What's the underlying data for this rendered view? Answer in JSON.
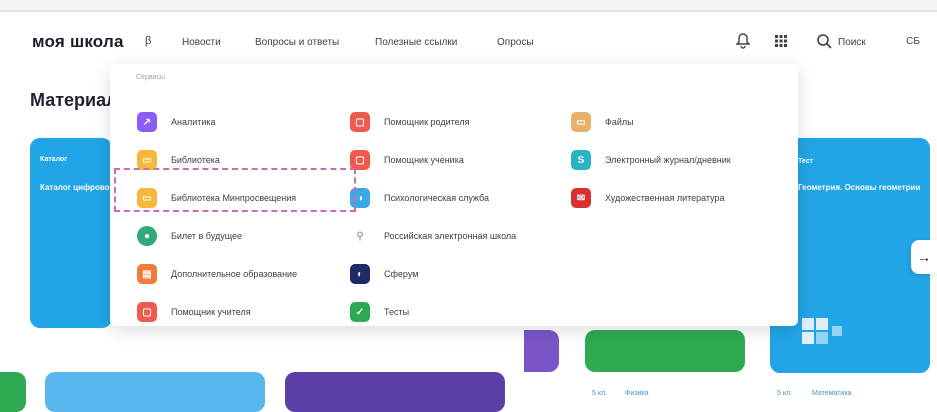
{
  "header": {
    "logo": "моя школа",
    "beta": "β",
    "nav": [
      "Новости",
      "Вопросы и ответы",
      "Полезные ссылки",
      "Опросы"
    ],
    "search_label": "Поиск",
    "avatar_initials": "СБ"
  },
  "page": {
    "title": "Материал"
  },
  "dropdown": {
    "heading": "Сервисы",
    "items": [
      {
        "label": "Аналитика",
        "icon": "analytics-icon",
        "color": "#8b5cf6"
      },
      {
        "label": "Библиотека",
        "icon": "library-icon",
        "color": "#f6b73c"
      },
      {
        "label": "Библиотека Минпросвещения",
        "icon": "library-icon",
        "color": "#f6b73c"
      },
      {
        "label": "Билет в будущее",
        "icon": "ticket-icon",
        "color": "#2faa7a"
      },
      {
        "label": "Дополнительное образование",
        "icon": "education-icon",
        "color": "#f27a3a"
      },
      {
        "label": "Помощник учителя",
        "icon": "teacher-helper-icon",
        "color": "#ef5a4f"
      },
      {
        "label": "Помощник родителя",
        "icon": "parent-helper-icon",
        "color": "#ef5a4f"
      },
      {
        "label": "Помощник ученика",
        "icon": "student-helper-icon",
        "color": "#ef5a4f"
      },
      {
        "label": "Психологическая служба",
        "icon": "psychology-icon",
        "color": "#3aa9e8"
      },
      {
        "label": "Российская электронная школа",
        "icon": "res-icon",
        "color": "#9aa0ab"
      },
      {
        "label": "Сферум",
        "icon": "sferum-icon",
        "color": "#1d2b6b"
      },
      {
        "label": "Тесты",
        "icon": "tests-icon",
        "color": "#2faa52"
      },
      {
        "label": "Файлы",
        "icon": "files-icon",
        "color": "#e8b06a"
      },
      {
        "label": "Электронный журнал/дневник",
        "icon": "journal-icon",
        "color": "#2ab3c2"
      },
      {
        "label": "Художественная литература",
        "icon": "fiction-icon",
        "color": "#d93030"
      }
    ]
  },
  "cards": {
    "left_tag": "Каталог",
    "left_text": "Каталог цифрового образовательного контента",
    "right_tag": "Тест",
    "right_text": "Геометрия. Основы геометрии",
    "meta": [
      "5 кл.",
      "Физика",
      "5 кл.",
      "Математика"
    ]
  },
  "colors": {
    "accent": "#22a5e6",
    "highlight": "#d06aad"
  }
}
